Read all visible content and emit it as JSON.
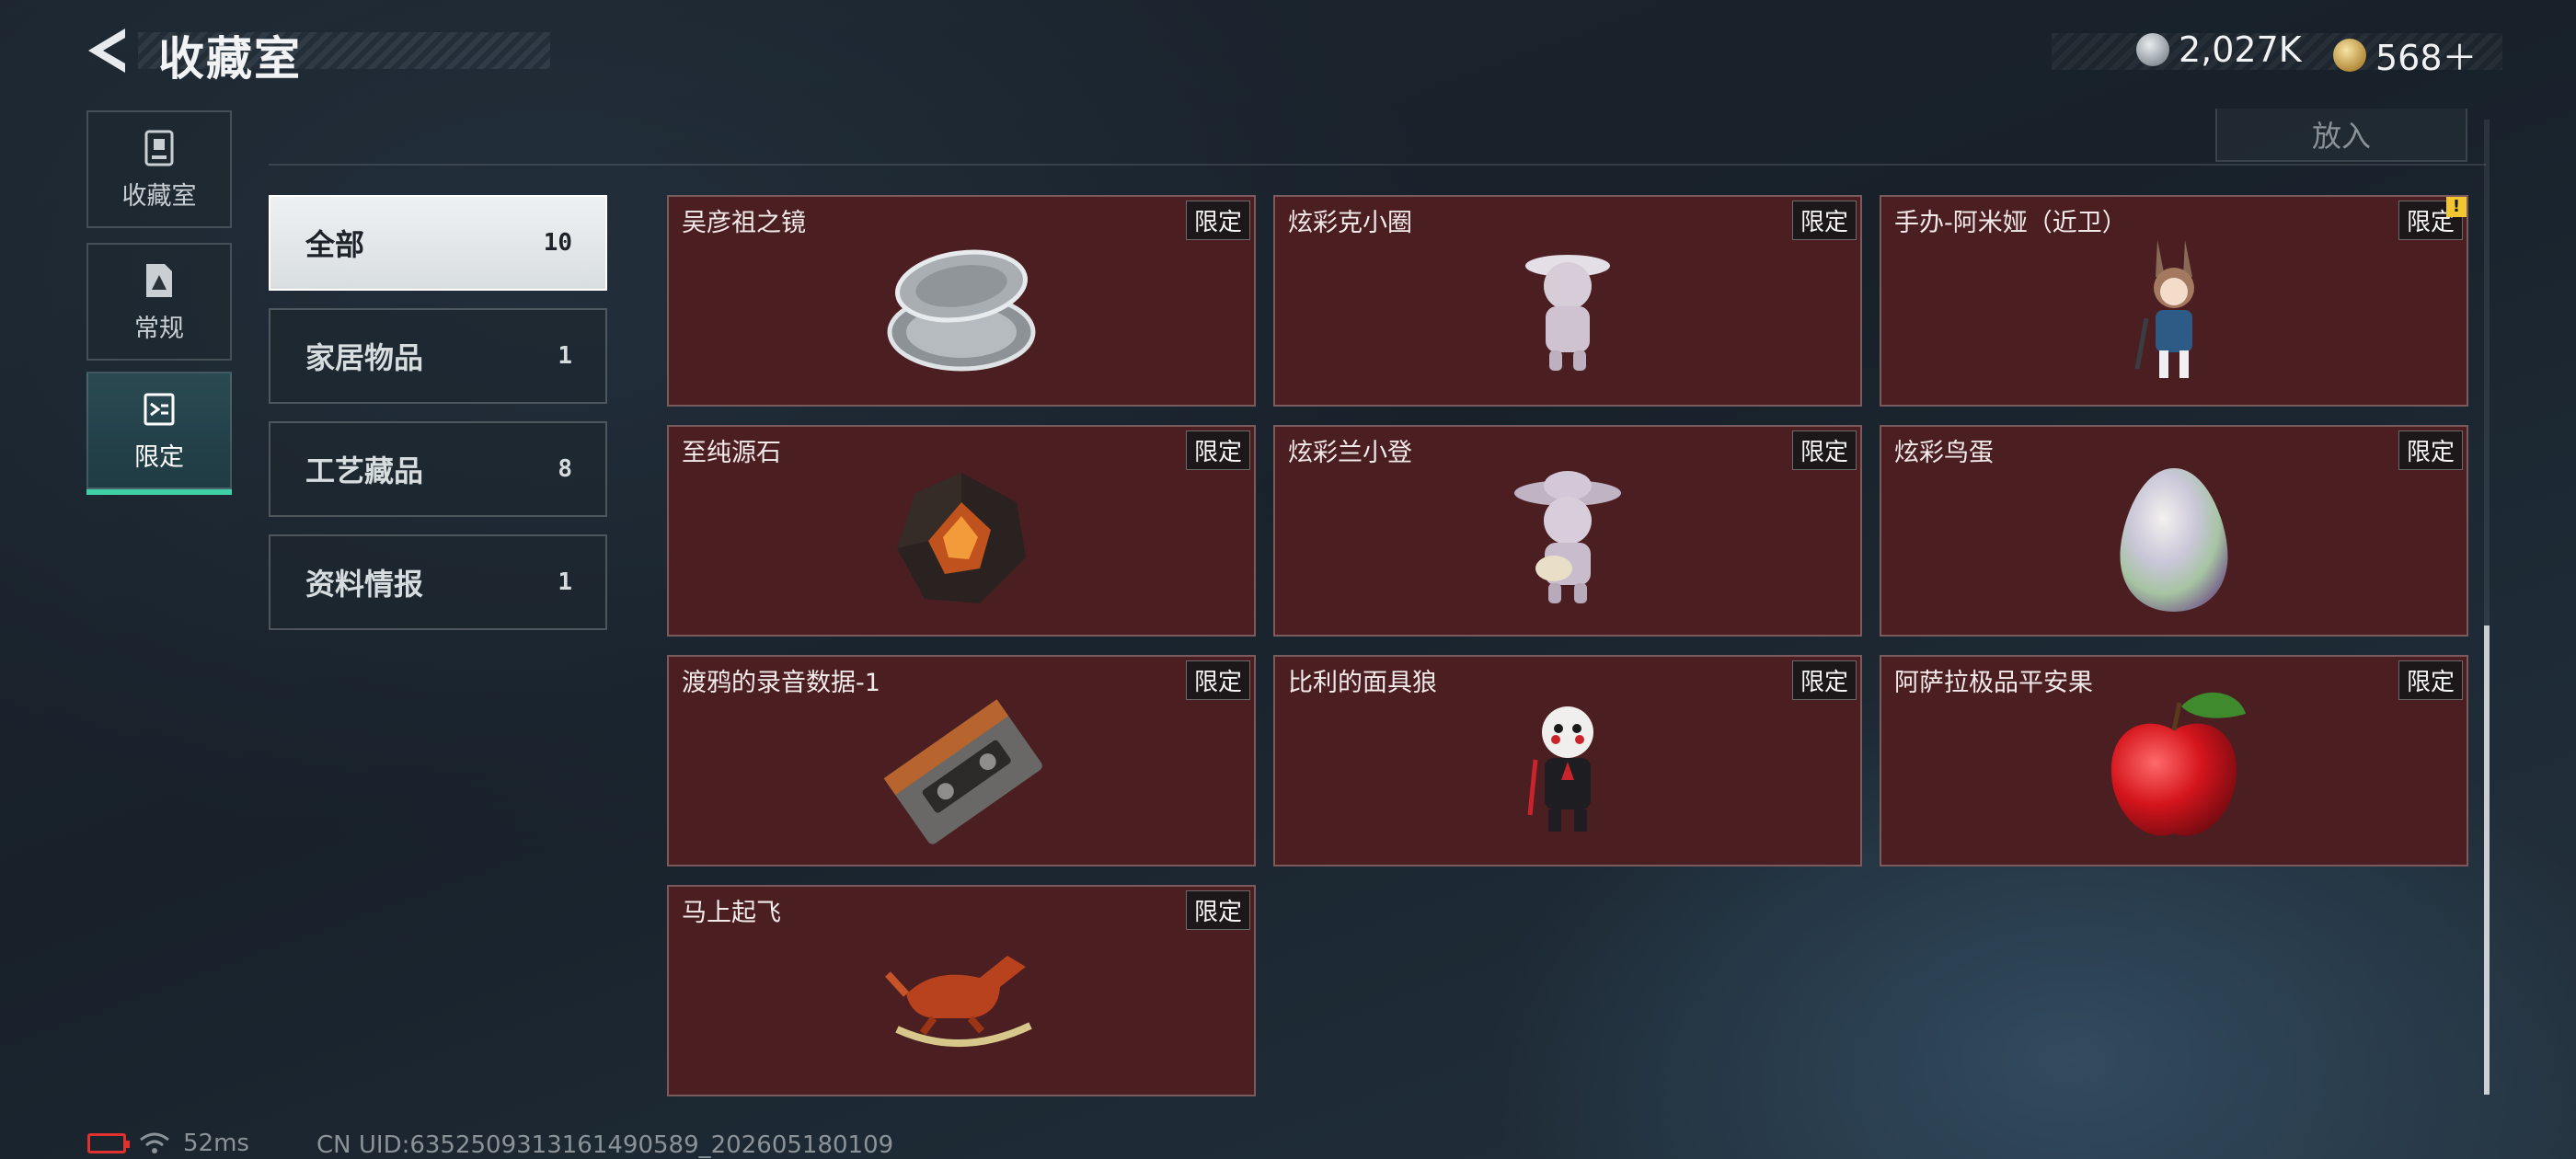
{
  "header": {
    "title": "收藏室",
    "currency": [
      {
        "icon": "silver-coin-icon",
        "value": "2,027K"
      },
      {
        "icon": "gold-coin-icon",
        "value": "568＋"
      }
    ]
  },
  "side_nav": [
    {
      "label": "收藏室",
      "icon": "trophy-room-icon",
      "active": false
    },
    {
      "label": "常规",
      "icon": "document-icon",
      "active": false
    },
    {
      "label": "限定",
      "icon": "limited-icon",
      "active": true
    }
  ],
  "place_button": "放入",
  "filters": [
    {
      "name": "全部",
      "count": "10",
      "active": true
    },
    {
      "name": "家居物品",
      "count": "1",
      "active": false
    },
    {
      "name": "工艺藏品",
      "count": "8",
      "active": false
    },
    {
      "name": "资料情报",
      "count": "1",
      "active": false
    }
  ],
  "items": [
    {
      "name": "吴彦祖之镜",
      "tag": "限定",
      "icon": "compact-mirror-icon"
    },
    {
      "name": "炫彩克小圈",
      "tag": "限定",
      "icon": "figurine-icon"
    },
    {
      "name": "手办-阿米娅（近卫）",
      "tag": "限定",
      "icon": "anime-figure-icon",
      "alert": "!"
    },
    {
      "name": "至纯源石",
      "tag": "限定",
      "icon": "crystal-stone-icon"
    },
    {
      "name": "炫彩兰小登",
      "tag": "限定",
      "icon": "sombrero-figurine-icon"
    },
    {
      "name": "炫彩鸟蛋",
      "tag": "限定",
      "icon": "egg-icon"
    },
    {
      "name": "渡鸦的录音数据-1",
      "tag": "限定",
      "icon": "cassette-tape-icon"
    },
    {
      "name": "比利的面具狼",
      "tag": "限定",
      "icon": "puppet-figure-icon"
    },
    {
      "name": "阿萨拉极品平安果",
      "tag": "限定",
      "icon": "apple-icon"
    },
    {
      "name": "马上起飞",
      "tag": "限定",
      "icon": "rocking-horse-icon"
    }
  ],
  "footer": {
    "ping": "52ms",
    "uid": "CN UID:6352509313161490589_202605180109"
  },
  "colors": {
    "accent": "#3fd0a7",
    "card_bg": "#4b1e22",
    "badge": "#f3c531",
    "battery_low": "#e0302f"
  }
}
